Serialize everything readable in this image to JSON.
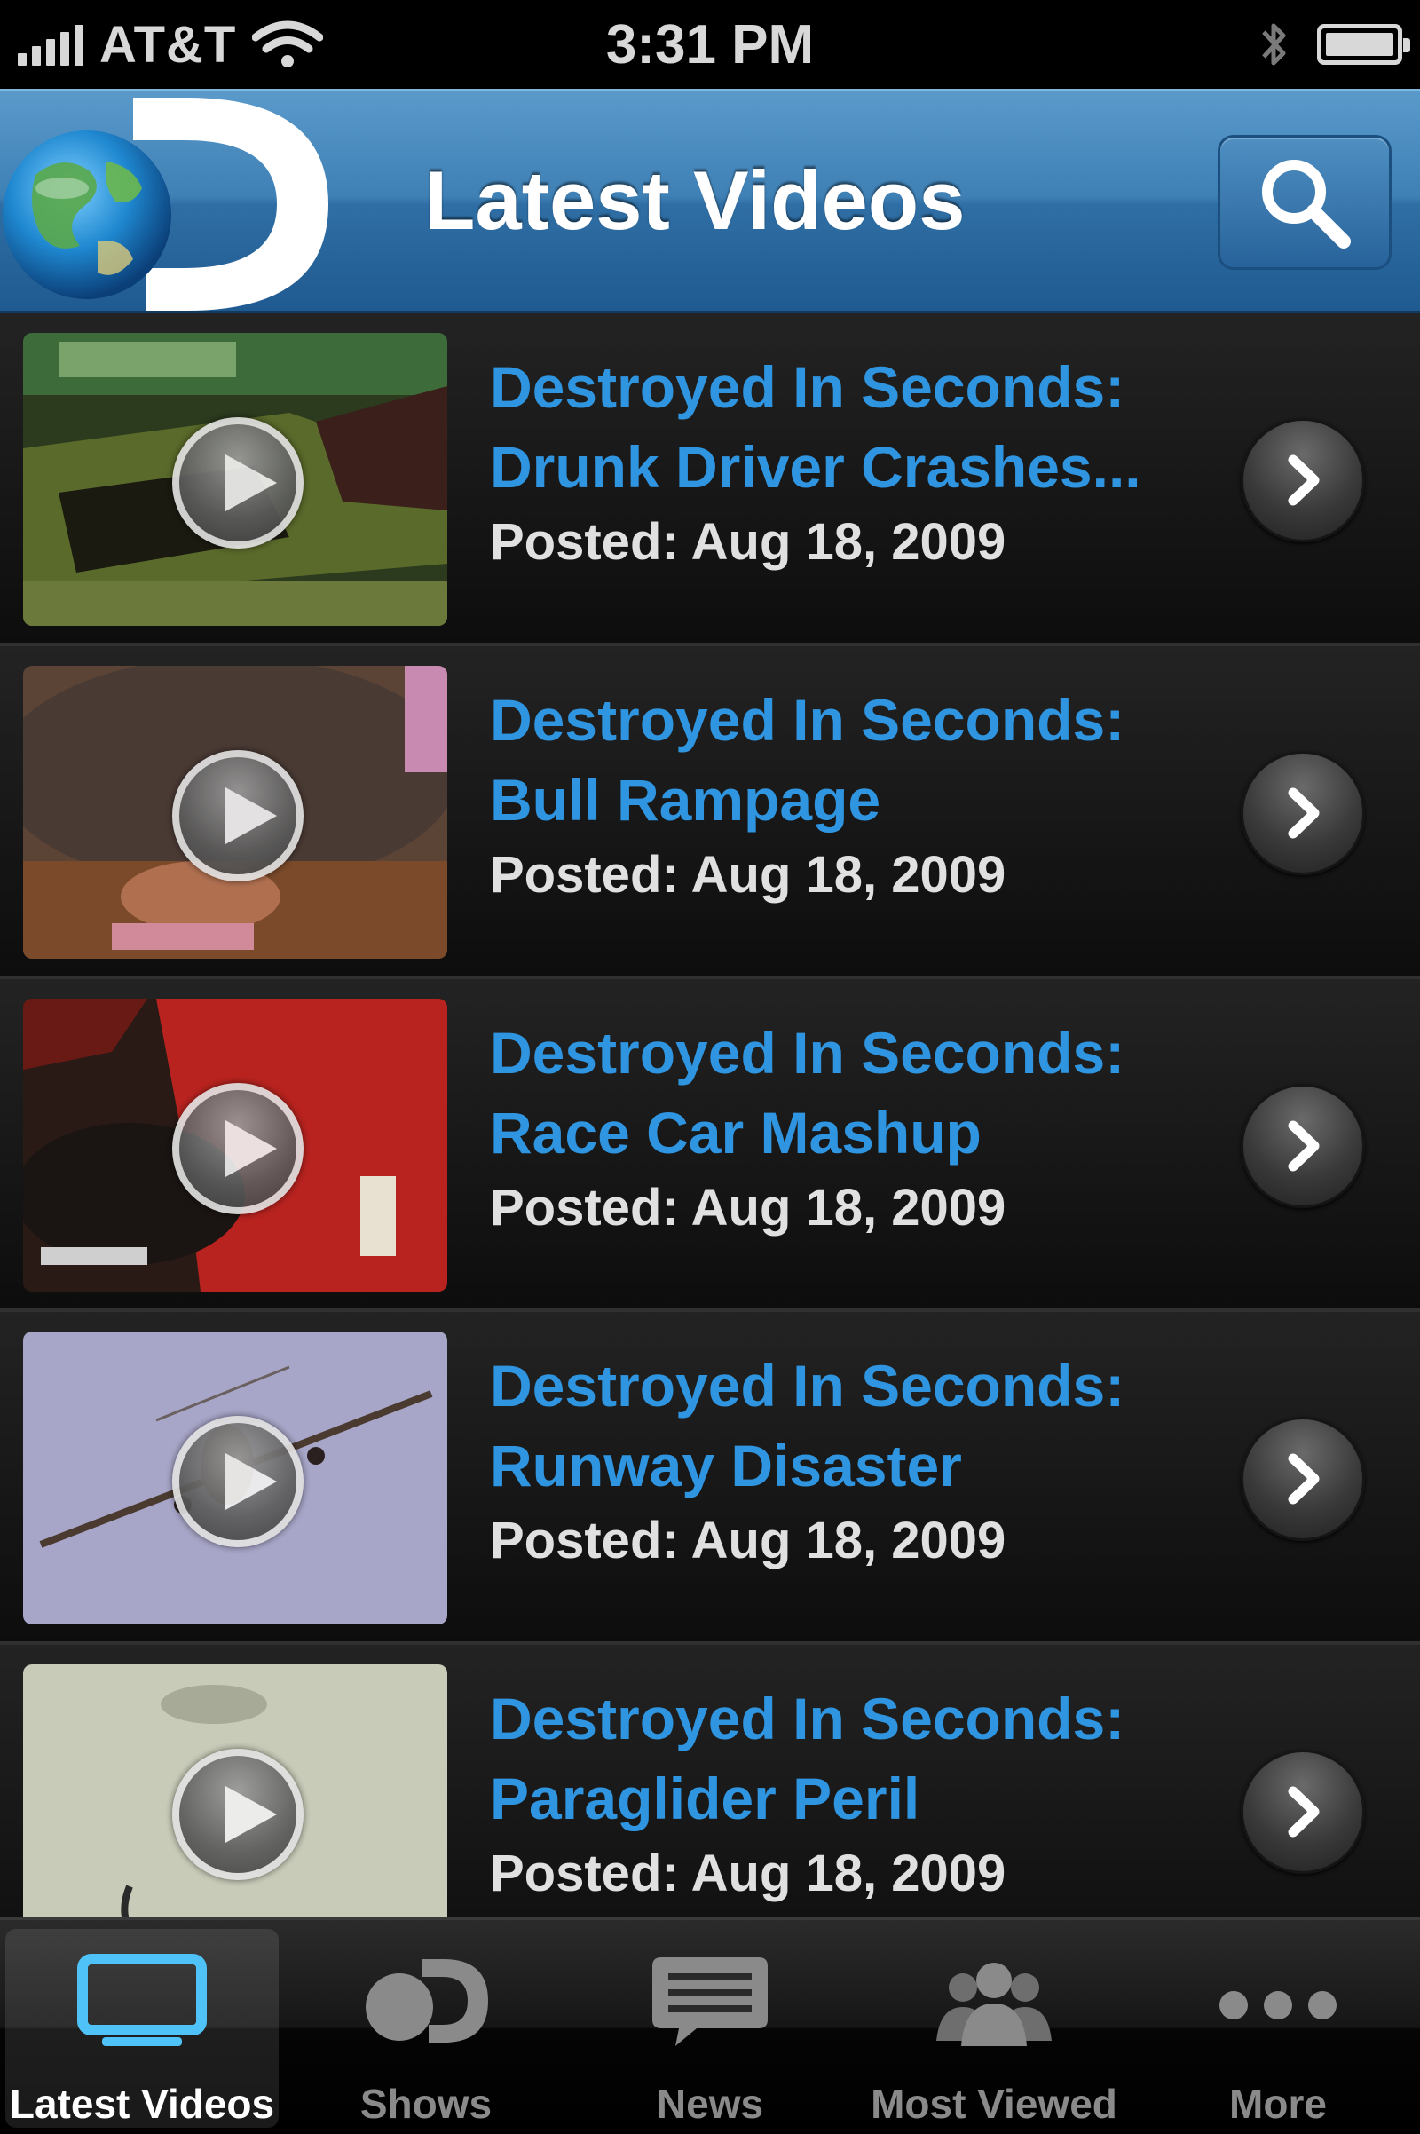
{
  "status_bar": {
    "carrier": "AT&T",
    "time": "3:31 PM"
  },
  "nav": {
    "title": "Latest Videos",
    "logo_icon": "discovery-globe-logo",
    "search_icon": "magnifier-icon"
  },
  "videos": [
    {
      "title_line1": "Destroyed In Seconds:",
      "title_line2": "Drunk Driver Crashes...",
      "posted": "Posted: Aug 18, 2009"
    },
    {
      "title_line1": "Destroyed In Seconds:",
      "title_line2": "Bull Rampage",
      "posted": "Posted: Aug 18, 2009"
    },
    {
      "title_line1": "Destroyed In Seconds:",
      "title_line2": "Race Car Mashup",
      "posted": "Posted: Aug 18, 2009"
    },
    {
      "title_line1": "Destroyed In Seconds:",
      "title_line2": "Runway Disaster",
      "posted": "Posted: Aug 18, 2009"
    },
    {
      "title_line1": "Destroyed In Seconds:",
      "title_line2": "Paraglider Peril",
      "posted": "Posted: Aug 18, 2009"
    }
  ],
  "tabs": [
    {
      "label": "Latest Videos",
      "icon": "tv-icon",
      "active": true
    },
    {
      "label": "Shows",
      "icon": "discovery-logo-icon",
      "active": false
    },
    {
      "label": "News",
      "icon": "speech-bubble-icon",
      "active": false
    },
    {
      "label": "Most Viewed",
      "icon": "people-icon",
      "active": false
    },
    {
      "label": "More",
      "icon": "more-dots-icon",
      "active": false
    }
  ],
  "colors": {
    "accent_blue": "#2f95e0",
    "nav_blue": "#3f80b5",
    "tab_active": "#4fc3f7"
  }
}
